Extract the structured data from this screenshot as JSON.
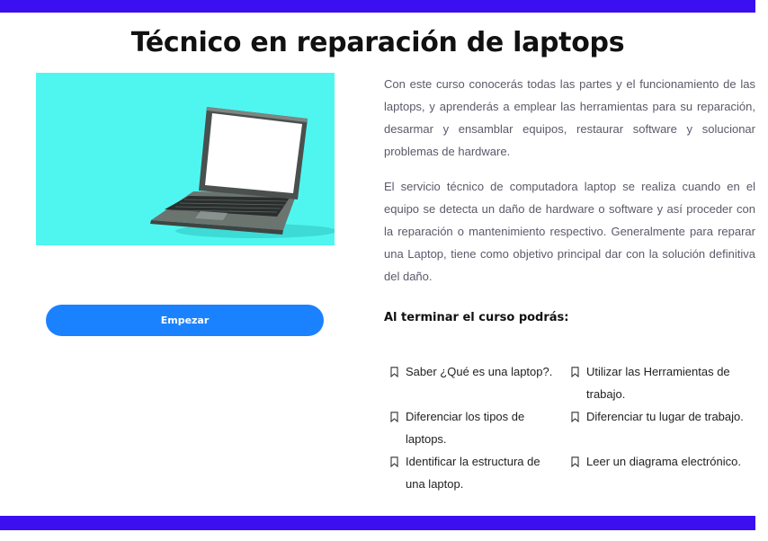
{
  "page": {
    "title": "Técnico en reparación de laptops",
    "start_button": "Empezar",
    "description": [
      "Con este curso conocerás todas las partes y el funcionamiento de las laptops, y aprenderás a emplear las herramientas para su reparación, desarmar y ensamblar equipos, restaurar software y solucionar problemas de hardware.",
      "El servicio técnico de computadora laptop se realiza cuando en el equipo se detecta un daño de hardware o software y así proceder con la reparación o mantenimiento respectivo. Generalmente para reparar una Laptop, tiene como objetivo principal dar con la solución definitiva del daño."
    ],
    "outcomes_heading": "Al terminar el curso podrás:",
    "outcomes_left": [
      "Saber ¿Qué es una laptop?.",
      "Diferenciar los tipos de laptops.",
      "Identificar la estructura de una laptop."
    ],
    "outcomes_right": [
      "Utilizar las Herramientas de trabajo.",
      "Diferenciar tu lugar de trabajo.",
      "Leer un diagrama electrónico."
    ],
    "list_icon": "bookmark-icon",
    "hero_image": "laptop-image"
  },
  "colors": {
    "top_bar": "#3b0ff0",
    "hero_background": "#4ff6f0",
    "button": "#1b82ff"
  }
}
